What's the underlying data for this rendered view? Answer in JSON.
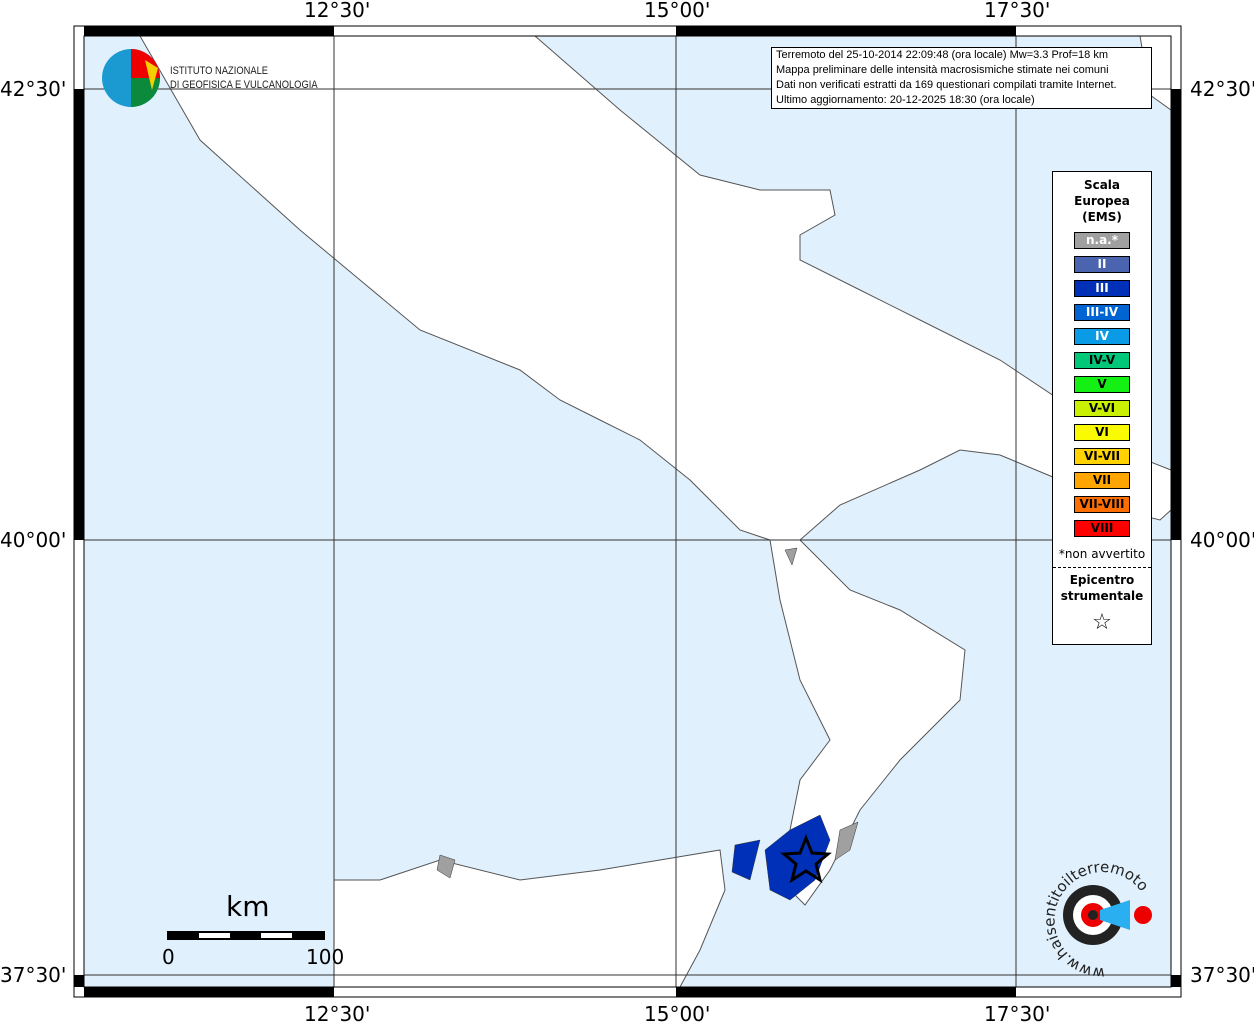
{
  "axes": {
    "top": [
      "12°30'",
      "15°00'",
      "17°30'"
    ],
    "bottom": [
      "12°30'",
      "15°00'",
      "17°30'"
    ],
    "left": [
      "42°30'",
      "40°00'",
      "37°30'"
    ],
    "right": [
      "42°30'",
      "40°00'",
      "37°30'"
    ]
  },
  "logo": {
    "line1": "ISTITUTO NAZIONALE",
    "line2": "DI GEOFISICA E VULCANOLOGIA"
  },
  "info": [
    "Terremoto del 25-10-2014 22:09:48 (ora locale) Mw=3.3 Prof=18 km",
    "Mappa preliminare delle intensità macrosismiche stimate nei comuni",
    "Dati non verificati estratti da 169 questionari compilati tramite Internet.",
    "Ultimo aggiornamento: 20-12-2025 18:30 (ora locale)"
  ],
  "legend": {
    "title": [
      "Scala",
      "Europea",
      "(EMS)"
    ],
    "items": [
      {
        "label": "n.a.*",
        "color": "#a0a0a0",
        "text": "#fff"
      },
      {
        "label": "II",
        "color": "#4a64b0",
        "text": "#fff"
      },
      {
        "label": "III",
        "color": "#0030b8",
        "text": "#fff"
      },
      {
        "label": "III-IV",
        "color": "#0064d2",
        "text": "#fff"
      },
      {
        "label": "IV",
        "color": "#0a9be6",
        "text": "#fff"
      },
      {
        "label": "IV-V",
        "color": "#00c878",
        "text": "#000"
      },
      {
        "label": "V",
        "color": "#14f014",
        "text": "#000"
      },
      {
        "label": "V-VI",
        "color": "#c8f000",
        "text": "#000"
      },
      {
        "label": "VI",
        "color": "#fafa00",
        "text": "#000"
      },
      {
        "label": "VI-VII",
        "color": "#ffd200",
        "text": "#000"
      },
      {
        "label": "VII",
        "color": "#ffa500",
        "text": "#000"
      },
      {
        "label": "VII-VIII",
        "color": "#ff6e00",
        "text": "#000"
      },
      {
        "label": "VIII",
        "color": "#ff0000",
        "text": "#000"
      }
    ],
    "note": "*non avvertito",
    "epicenter": [
      "Epicentro",
      "strumentale"
    ],
    "star": "☆"
  },
  "scale": {
    "unit": "km",
    "min": "0",
    "max": "100"
  },
  "brand": "www.haisentitoilterremoto.it",
  "colors": {
    "sea": "#e0f0fc",
    "land": "#ffffff"
  }
}
